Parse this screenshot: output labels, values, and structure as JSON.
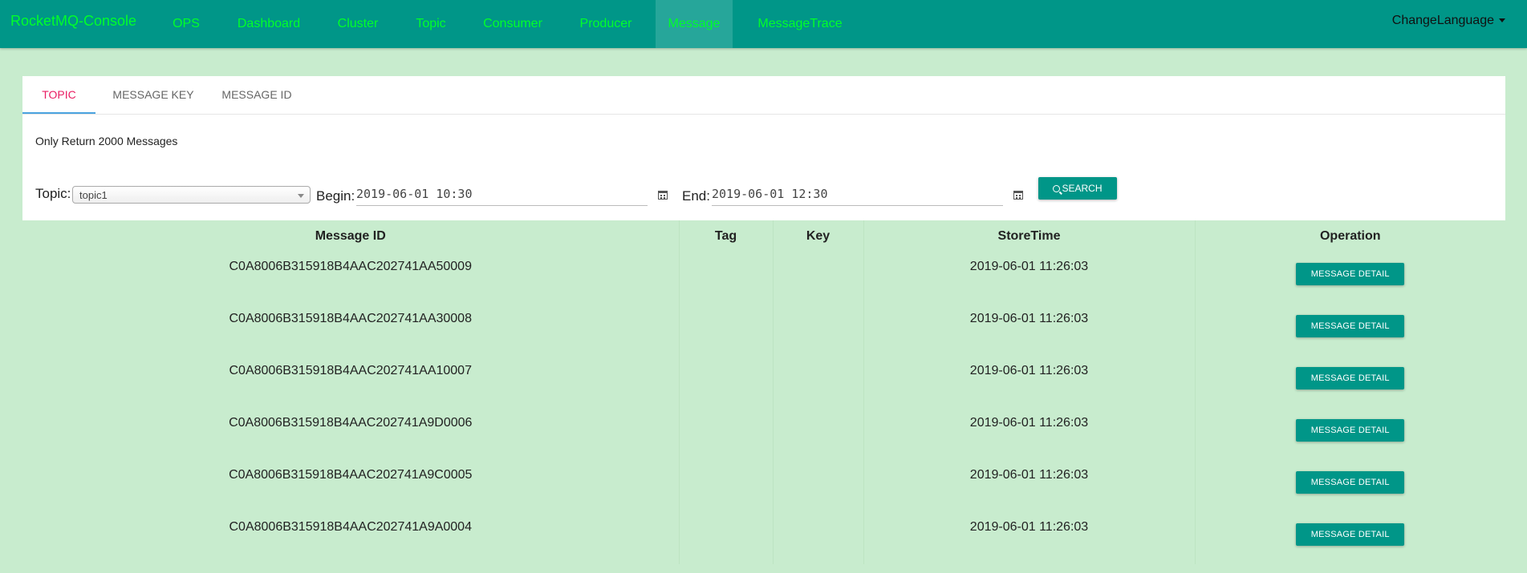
{
  "navbar": {
    "brand": "RocketMQ-Console",
    "items": [
      "OPS",
      "Dashboard",
      "Cluster",
      "Topic",
      "Consumer",
      "Producer",
      "Message",
      "MessageTrace"
    ],
    "active_item": "Message",
    "change_language": "ChangeLanguage"
  },
  "tabs": [
    "TOPIC",
    "MESSAGE KEY",
    "MESSAGE ID"
  ],
  "active_tab": "TOPIC",
  "note": "Only Return 2000 Messages",
  "filter": {
    "topic_label": "Topic:",
    "topic_value": "topic1",
    "begin_label": "Begin:",
    "begin_value": "2019-06-01 10:30",
    "end_label": "End:",
    "end_value": "2019-06-01 12:30",
    "search_label": "SEARCH"
  },
  "table": {
    "headers": [
      "Message ID",
      "Tag",
      "Key",
      "StoreTime",
      "Operation"
    ],
    "rows": [
      {
        "message_id": "C0A8006B315918B4AAC202741AA50009",
        "tag": "",
        "key": "",
        "store_time": "2019-06-01 11:26:03",
        "operation": "MESSAGE DETAIL"
      },
      {
        "message_id": "C0A8006B315918B4AAC202741AA30008",
        "tag": "",
        "key": "",
        "store_time": "2019-06-01 11:26:03",
        "operation": "MESSAGE DETAIL"
      },
      {
        "message_id": "C0A8006B315918B4AAC202741AA10007",
        "tag": "",
        "key": "",
        "store_time": "2019-06-01 11:26:03",
        "operation": "MESSAGE DETAIL"
      },
      {
        "message_id": "C0A8006B315918B4AAC202741A9D0006",
        "tag": "",
        "key": "",
        "store_time": "2019-06-01 11:26:03",
        "operation": "MESSAGE DETAIL"
      },
      {
        "message_id": "C0A8006B315918B4AAC202741A9C0005",
        "tag": "",
        "key": "",
        "store_time": "2019-06-01 11:26:03",
        "operation": "MESSAGE DETAIL"
      },
      {
        "message_id": "C0A8006B315918B4AAC202741A9A0004",
        "tag": "",
        "key": "",
        "store_time": "2019-06-01 11:26:03",
        "operation": "MESSAGE DETAIL"
      }
    ]
  },
  "colors": {
    "navbar": "#009688",
    "nav_text": "#00ff2a",
    "page_bg": "#c8ecce",
    "active_tab": "#e91e63",
    "button": "#009688"
  },
  "icons": {
    "search": "search-icon",
    "calendar": "calendar-icon",
    "caret": "caret-down-icon"
  }
}
